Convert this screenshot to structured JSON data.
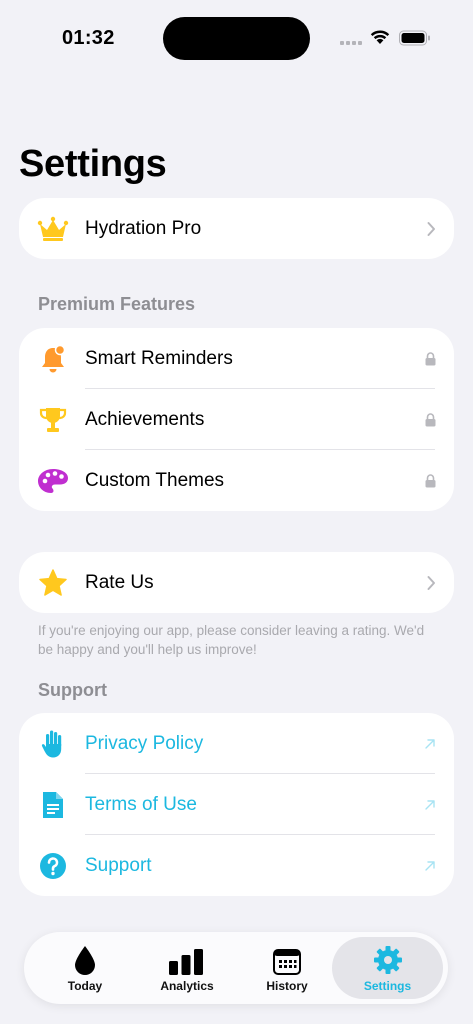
{
  "status": {
    "time": "01:32"
  },
  "page": {
    "title": "Settings"
  },
  "pro_card": {
    "label": "Hydration Pro",
    "icon": "crown-icon"
  },
  "premium": {
    "header": "Premium Features",
    "items": [
      {
        "label": "Smart Reminders",
        "icon": "bell-badge-icon"
      },
      {
        "label": "Achievements",
        "icon": "trophy-icon"
      },
      {
        "label": "Custom Themes",
        "icon": "palette-icon"
      }
    ]
  },
  "rate": {
    "label": "Rate Us",
    "icon": "star-icon",
    "footnote": "If you're enjoying our app, please consider leaving a rating. We'd be happy and you'll help us improve!"
  },
  "support": {
    "header": "Support",
    "items": [
      {
        "label": "Privacy Policy",
        "icon": "hand-raised-icon"
      },
      {
        "label": "Terms of Use",
        "icon": "document-icon"
      },
      {
        "label": "Support",
        "icon": "question-circle-icon"
      }
    ]
  },
  "tabs": [
    {
      "label": "Today",
      "icon": "drop-icon"
    },
    {
      "label": "Analytics",
      "icon": "bar-chart-icon"
    },
    {
      "label": "History",
      "icon": "calendar-icon"
    },
    {
      "label": "Settings",
      "icon": "gear-icon",
      "active": true
    }
  ],
  "colors": {
    "accent": "#1cb8e0",
    "background": "#f2f2f7",
    "gold": "#ffc81e",
    "orange": "#ff9a2e",
    "purple": "#c02fd0"
  }
}
